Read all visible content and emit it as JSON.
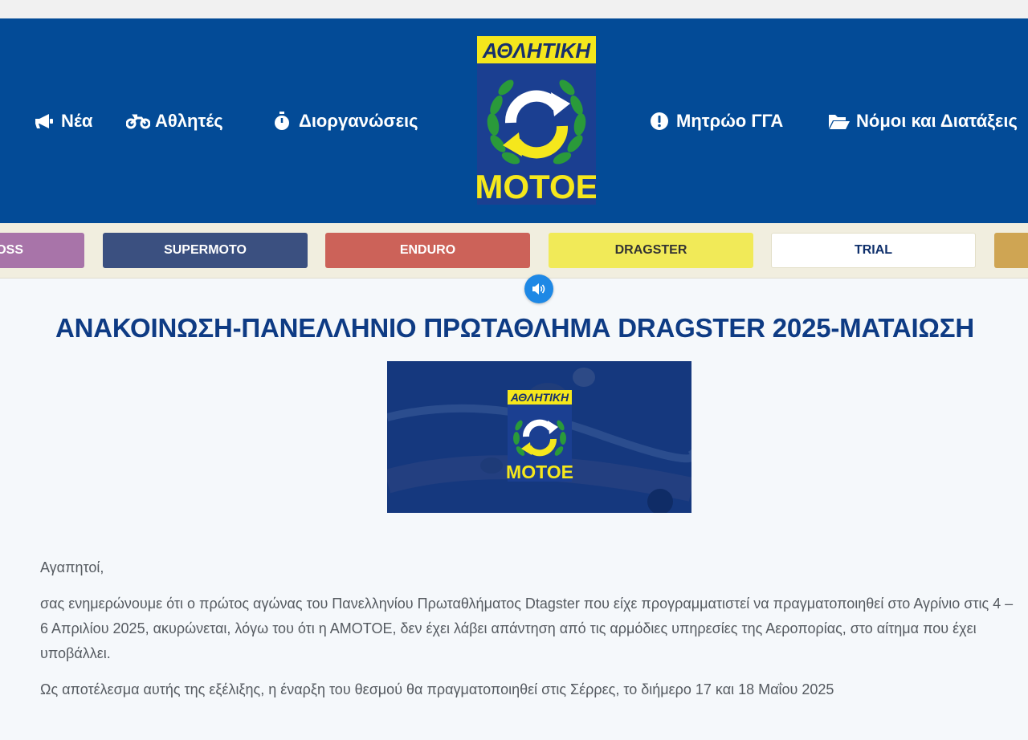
{
  "nav": {
    "items": [
      {
        "label": "Νέα",
        "icon": "megaphone-icon"
      },
      {
        "label": "Αθλητές",
        "icon": "motorcycle-icon"
      },
      {
        "label": "Διοργανώσεις",
        "icon": "stopwatch-icon"
      },
      {
        "label": "Μητρώο ΓΓΑ",
        "icon": "exclamation-circle-icon"
      },
      {
        "label": "Νόμοι και Διατάξεις",
        "icon": "folder-open-icon"
      }
    ]
  },
  "logo": {
    "top_text": "ΑΘΛΗΤΙΚΗ",
    "bottom_text": "ΜΟΤΟΕ"
  },
  "categories": [
    {
      "label": "OSS",
      "bg": "#a874a9",
      "color": "#ffffff"
    },
    {
      "label": "SUPERMOTO",
      "bg": "#3b5080",
      "color": "#ffffff"
    },
    {
      "label": "ENDURO",
      "bg": "#cc6259",
      "color": "#ffffff"
    },
    {
      "label": "DRAGSTER",
      "bg": "#f1ea58",
      "color": "#333333"
    },
    {
      "label": "TRIAL",
      "bg": "#ffffff",
      "color": "#0e2f6b"
    },
    {
      "label": "",
      "bg": "#cfa553",
      "color": "#ffffff"
    }
  ],
  "article": {
    "title": "ΑΝΑΚΟΙΝΩΣΗ-ΠΑΝΕΛΛΗΝΙΟ ΠΡΩΤΑΘΛΗΜΑ DRAGSTER 2025-ΜΑΤΑΙΩΣΗ",
    "image_logo_top": "ΑΘΛΗΤΙΚΗ",
    "image_logo_bottom": "ΜΟΤΟΕ",
    "paragraphs": [
      "Αγαπητοί,",
      "σας ενημερώνουμε ότι ο πρώτος αγώνας του Πανελληνίου Πρωταθλήματος Dtagster που είχε προγραμματιστεί να πραγματοποιηθεί στο Αγρίνιο στις 4 – 6 Απριλίου 2025, ακυρώνεται, λόγω του ότι η ΑΜΟΤΟΕ, δεν έχει λάβει απάντηση από τις αρμόδιες υπηρεσίες της Αεροπορίας, στο αίτημα που έχει υποβάλλει.",
      "Ως αποτέλεσμα αυτής της εξέλιξης, η έναρξη του θεσμού θα πραγματοποιηθεί στις Σέρρες, το διήμερο 17 και 18 Μαΐου 2025"
    ]
  },
  "colors": {
    "header_bg": "#034b97",
    "title": "#0e3b84",
    "logo_yellow": "#f5e71c",
    "audio_button": "#1e88e5"
  }
}
